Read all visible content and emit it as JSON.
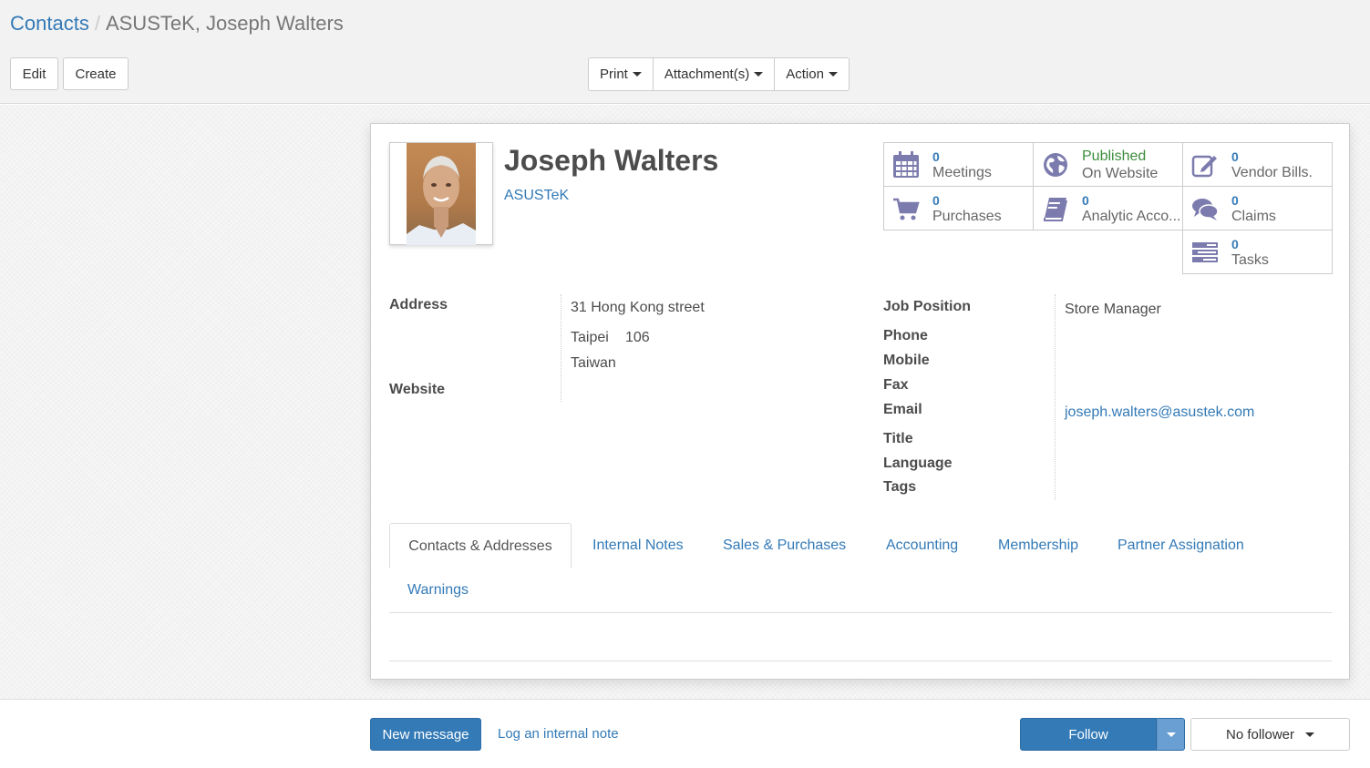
{
  "breadcrumb": {
    "parent": "Contacts",
    "separator": "/",
    "current": "ASUSTeK, Joseph Walters"
  },
  "toolbar": {
    "edit": "Edit",
    "create": "Create",
    "print": "Print",
    "attachments": "Attachment(s)",
    "action": "Action"
  },
  "partner": {
    "name": "Joseph Walters",
    "company": "ASUSTeK"
  },
  "smart_buttons": {
    "meetings": {
      "count": "0",
      "label": "Meetings",
      "icon": "calendar-icon"
    },
    "website": {
      "line1": "Published",
      "line2": "On Website",
      "icon": "globe-icon"
    },
    "vendor_bills": {
      "count": "0",
      "label": "Vendor Bills.",
      "icon": "pencil-square-icon"
    },
    "purchases": {
      "count": "0",
      "label": "Purchases",
      "icon": "shopping-cart-icon"
    },
    "analytic": {
      "count": "0",
      "label": "Analytic Acco...",
      "icon": "book-icon"
    },
    "claims": {
      "count": "0",
      "label": "Claims",
      "icon": "comments-icon"
    },
    "tasks": {
      "count": "0",
      "label": "Tasks",
      "icon": "tasks-icon"
    }
  },
  "fields": {
    "address_label": "Address",
    "street": "31 Hong Kong street",
    "city": "Taipei",
    "zip": "106",
    "country": "Taiwan",
    "website_label": "Website",
    "job_position_label": "Job Position",
    "job_position": "Store Manager",
    "phone_label": "Phone",
    "mobile_label": "Mobile",
    "fax_label": "Fax",
    "email_label": "Email",
    "email": "joseph.walters@asustek.com",
    "title_label": "Title",
    "language_label": "Language",
    "tags_label": "Tags"
  },
  "tabs": [
    "Contacts & Addresses",
    "Internal Notes",
    "Sales & Purchases",
    "Accounting",
    "Membership",
    "Partner Assignation",
    "Warnings"
  ],
  "chatter": {
    "new_message": "New message",
    "log_note": "Log an internal note",
    "follow": "Follow",
    "followers": "No follower"
  },
  "colors": {
    "link": "#337ab7",
    "primary": "#337ab7",
    "published": "#3c8d3c",
    "icon": "#7c7bad"
  }
}
